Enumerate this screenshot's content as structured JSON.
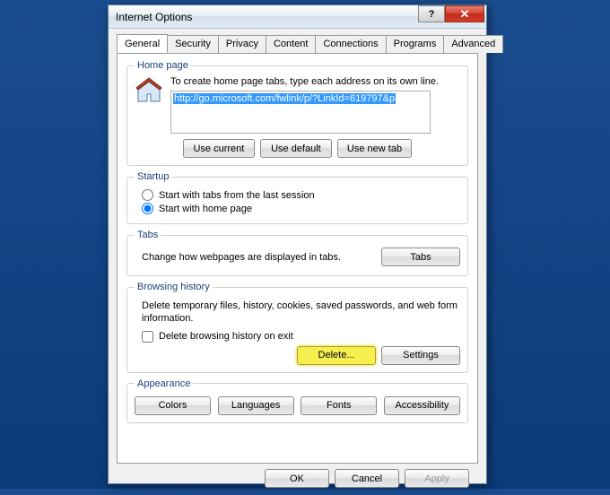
{
  "window": {
    "title": "Internet Options",
    "help": "?",
    "close": "✕"
  },
  "tabs": [
    "General",
    "Security",
    "Privacy",
    "Content",
    "Connections",
    "Programs",
    "Advanced"
  ],
  "homepage": {
    "legend": "Home page",
    "instruction": "To create home page tabs, type each address on its own line.",
    "url": "http://go.microsoft.com/fwlink/p/?LinkId=619797&p",
    "use_current": "Use current",
    "use_default": "Use default",
    "use_new_tab": "Use new tab"
  },
  "startup": {
    "legend": "Startup",
    "opt_last": "Start with tabs from the last session",
    "opt_home": "Start with home page"
  },
  "tabsgroup": {
    "legend": "Tabs",
    "text": "Change how webpages are displayed in tabs.",
    "btn": "Tabs"
  },
  "history": {
    "legend": "Browsing history",
    "text": "Delete temporary files, history, cookies, saved passwords, and web form information.",
    "checkbox": "Delete browsing history on exit",
    "delete": "Delete...",
    "settings": "Settings"
  },
  "appearance": {
    "legend": "Appearance",
    "colors": "Colors",
    "languages": "Languages",
    "fonts": "Fonts",
    "accessibility": "Accessibility"
  },
  "footer": {
    "ok": "OK",
    "cancel": "Cancel",
    "apply": "Apply"
  }
}
